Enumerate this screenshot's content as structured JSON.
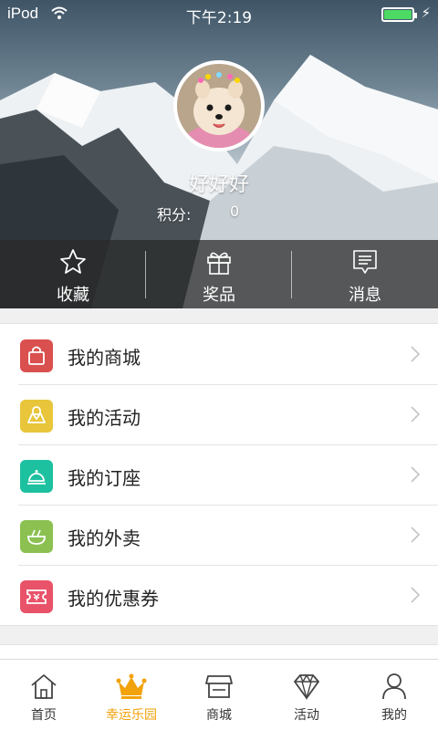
{
  "status_bar": {
    "carrier": "iPod",
    "time": "下午2:19"
  },
  "profile": {
    "username": "好好好",
    "points_label": "积分:",
    "points_value": "0"
  },
  "quick_actions": [
    {
      "label": "收藏",
      "icon": "star-icon"
    },
    {
      "label": "奖品",
      "icon": "gift-icon"
    },
    {
      "label": "消息",
      "icon": "message-icon"
    }
  ],
  "menu": [
    {
      "label": "我的商城",
      "icon": "shopping-bag-icon",
      "color": "#d9504e"
    },
    {
      "label": "我的活动",
      "icon": "map-pin-icon",
      "color": "#e8c53a"
    },
    {
      "label": "我的订座",
      "icon": "service-bell-icon",
      "color": "#1dc1a0"
    },
    {
      "label": "我的外卖",
      "icon": "food-bowl-icon",
      "color": "#8cc152"
    },
    {
      "label": "我的优惠券",
      "icon": "coupon-icon",
      "color": "#e9536a"
    }
  ],
  "tabbar": [
    {
      "label": "首页",
      "icon": "home-icon"
    },
    {
      "label": "幸运乐园",
      "icon": "crown-icon",
      "active": true
    },
    {
      "label": "商城",
      "icon": "store-icon"
    },
    {
      "label": "活动",
      "icon": "diamond-icon"
    },
    {
      "label": "我的",
      "icon": "user-icon"
    }
  ],
  "colors": {
    "accent": "#f2a20a",
    "battery": "#4cd964"
  }
}
